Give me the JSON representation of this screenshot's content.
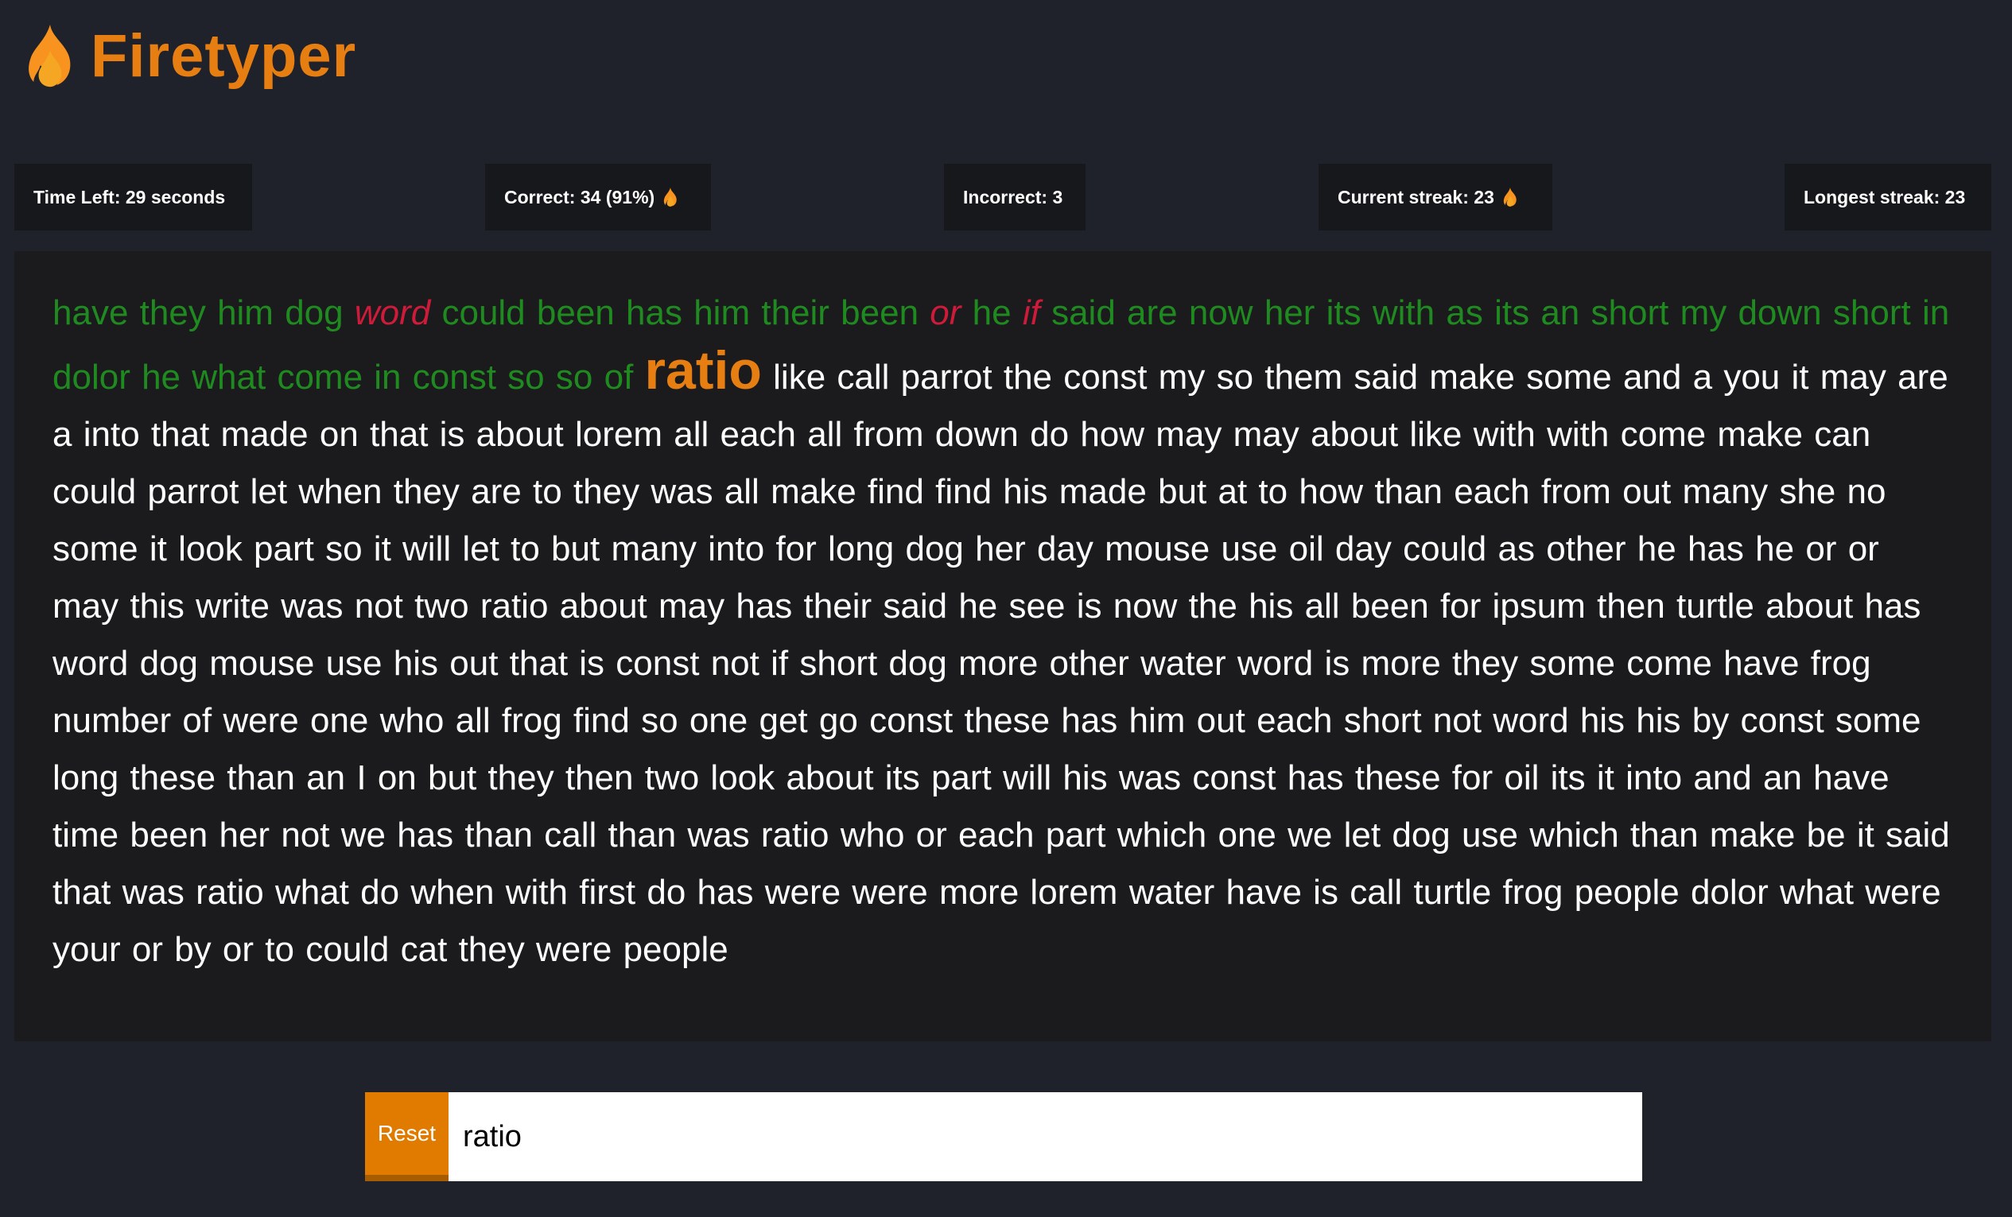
{
  "app": {
    "title": "Firetyper",
    "logo_icon": "flame-icon",
    "accent_color": "#e67e12"
  },
  "stats": {
    "time_left": {
      "label": "Time Left: ",
      "value": "29",
      "suffix": " seconds"
    },
    "correct": {
      "label": "Correct: ",
      "value": "34 (91%)",
      "icon": "flame-icon"
    },
    "incorrect": {
      "label": "Incorrect: ",
      "value": "3"
    },
    "current_streak": {
      "label": "Current streak: ",
      "value": "23",
      "icon": "flame-icon"
    },
    "longest_streak": {
      "label": "Longest streak: ",
      "value": "23"
    }
  },
  "colors": {
    "correct": "#1f8a1f",
    "incorrect": "#cf1b3a",
    "current": "#e67e12",
    "pending": "#ffffff"
  },
  "words": [
    {
      "t": "have",
      "s": "correct"
    },
    {
      "t": "they",
      "s": "correct"
    },
    {
      "t": "him",
      "s": "correct"
    },
    {
      "t": "dog",
      "s": "correct"
    },
    {
      "t": "word",
      "s": "incorrect"
    },
    {
      "t": "could",
      "s": "correct"
    },
    {
      "t": "been",
      "s": "correct"
    },
    {
      "t": "has",
      "s": "correct"
    },
    {
      "t": "him",
      "s": "correct"
    },
    {
      "t": "their",
      "s": "correct"
    },
    {
      "t": "been",
      "s": "correct"
    },
    {
      "t": "or",
      "s": "incorrect"
    },
    {
      "t": "he",
      "s": "correct"
    },
    {
      "t": "if",
      "s": "incorrect"
    },
    {
      "t": "said",
      "s": "correct"
    },
    {
      "t": "are",
      "s": "correct"
    },
    {
      "t": "now",
      "s": "correct"
    },
    {
      "t": "her",
      "s": "correct"
    },
    {
      "t": "its",
      "s": "correct"
    },
    {
      "t": "with",
      "s": "correct"
    },
    {
      "t": "as",
      "s": "correct"
    },
    {
      "t": "its",
      "s": "correct"
    },
    {
      "t": "an",
      "s": "correct"
    },
    {
      "t": "short",
      "s": "correct"
    },
    {
      "t": "my",
      "s": "correct"
    },
    {
      "t": "down",
      "s": "correct"
    },
    {
      "t": "short",
      "s": "correct"
    },
    {
      "t": "in",
      "s": "correct"
    },
    {
      "t": "dolor",
      "s": "correct"
    },
    {
      "t": "he",
      "s": "correct"
    },
    {
      "t": "what",
      "s": "correct"
    },
    {
      "t": "come",
      "s": "correct"
    },
    {
      "t": "in",
      "s": "correct"
    },
    {
      "t": "const",
      "s": "correct"
    },
    {
      "t": "so",
      "s": "correct"
    },
    {
      "t": "so",
      "s": "correct"
    },
    {
      "t": "of",
      "s": "correct"
    },
    {
      "t": "ratio",
      "s": "current"
    },
    {
      "t": "like",
      "s": "pending"
    },
    {
      "t": "call",
      "s": "pending"
    },
    {
      "t": "parrot",
      "s": "pending"
    },
    {
      "t": "the",
      "s": "pending"
    },
    {
      "t": "const",
      "s": "pending"
    },
    {
      "t": "my",
      "s": "pending"
    },
    {
      "t": "so",
      "s": "pending"
    },
    {
      "t": "them",
      "s": "pending"
    },
    {
      "t": "said",
      "s": "pending"
    },
    {
      "t": "make",
      "s": "pending"
    },
    {
      "t": "some",
      "s": "pending"
    },
    {
      "t": "and",
      "s": "pending"
    },
    {
      "t": "a",
      "s": "pending"
    },
    {
      "t": "you",
      "s": "pending"
    },
    {
      "t": "it",
      "s": "pending"
    },
    {
      "t": "may",
      "s": "pending"
    },
    {
      "t": "are",
      "s": "pending"
    },
    {
      "t": "a",
      "s": "pending"
    },
    {
      "t": "into",
      "s": "pending"
    },
    {
      "t": "that",
      "s": "pending"
    },
    {
      "t": "made",
      "s": "pending"
    },
    {
      "t": "on",
      "s": "pending"
    },
    {
      "t": "that",
      "s": "pending"
    },
    {
      "t": "is",
      "s": "pending"
    },
    {
      "t": "about",
      "s": "pending"
    },
    {
      "t": "lorem",
      "s": "pending"
    },
    {
      "t": "all",
      "s": "pending"
    },
    {
      "t": "each",
      "s": "pending"
    },
    {
      "t": "all",
      "s": "pending"
    },
    {
      "t": "from",
      "s": "pending"
    },
    {
      "t": "down",
      "s": "pending"
    },
    {
      "t": "do",
      "s": "pending"
    },
    {
      "t": "how",
      "s": "pending"
    },
    {
      "t": "may",
      "s": "pending"
    },
    {
      "t": "may",
      "s": "pending"
    },
    {
      "t": "about",
      "s": "pending"
    },
    {
      "t": "like",
      "s": "pending"
    },
    {
      "t": "with",
      "s": "pending"
    },
    {
      "t": "with",
      "s": "pending"
    },
    {
      "t": "come",
      "s": "pending"
    },
    {
      "t": "make",
      "s": "pending"
    },
    {
      "t": "can",
      "s": "pending"
    },
    {
      "t": "could",
      "s": "pending"
    },
    {
      "t": "parrot",
      "s": "pending"
    },
    {
      "t": "let",
      "s": "pending"
    },
    {
      "t": "when",
      "s": "pending"
    },
    {
      "t": "they",
      "s": "pending"
    },
    {
      "t": "are",
      "s": "pending"
    },
    {
      "t": "to",
      "s": "pending"
    },
    {
      "t": "they",
      "s": "pending"
    },
    {
      "t": "was",
      "s": "pending"
    },
    {
      "t": "all",
      "s": "pending"
    },
    {
      "t": "make",
      "s": "pending"
    },
    {
      "t": "find",
      "s": "pending"
    },
    {
      "t": "find",
      "s": "pending"
    },
    {
      "t": "his",
      "s": "pending"
    },
    {
      "t": "made",
      "s": "pending"
    },
    {
      "t": "but",
      "s": "pending"
    },
    {
      "t": "at",
      "s": "pending"
    },
    {
      "t": "to",
      "s": "pending"
    },
    {
      "t": "how",
      "s": "pending"
    },
    {
      "t": "than",
      "s": "pending"
    },
    {
      "t": "each",
      "s": "pending"
    },
    {
      "t": "from",
      "s": "pending"
    },
    {
      "t": "out",
      "s": "pending"
    },
    {
      "t": "many",
      "s": "pending"
    },
    {
      "t": "she",
      "s": "pending"
    },
    {
      "t": "no",
      "s": "pending"
    },
    {
      "t": "some",
      "s": "pending"
    },
    {
      "t": "it",
      "s": "pending"
    },
    {
      "t": "look",
      "s": "pending"
    },
    {
      "t": "part",
      "s": "pending"
    },
    {
      "t": "so",
      "s": "pending"
    },
    {
      "t": "it",
      "s": "pending"
    },
    {
      "t": "will",
      "s": "pending"
    },
    {
      "t": "let",
      "s": "pending"
    },
    {
      "t": "to",
      "s": "pending"
    },
    {
      "t": "but",
      "s": "pending"
    },
    {
      "t": "many",
      "s": "pending"
    },
    {
      "t": "into",
      "s": "pending"
    },
    {
      "t": "for",
      "s": "pending"
    },
    {
      "t": "long",
      "s": "pending"
    },
    {
      "t": "dog",
      "s": "pending"
    },
    {
      "t": "her",
      "s": "pending"
    },
    {
      "t": "day",
      "s": "pending"
    },
    {
      "t": "mouse",
      "s": "pending"
    },
    {
      "t": "use",
      "s": "pending"
    },
    {
      "t": "oil",
      "s": "pending"
    },
    {
      "t": "day",
      "s": "pending"
    },
    {
      "t": "could",
      "s": "pending"
    },
    {
      "t": "as",
      "s": "pending"
    },
    {
      "t": "other",
      "s": "pending"
    },
    {
      "t": "he",
      "s": "pending"
    },
    {
      "t": "has",
      "s": "pending"
    },
    {
      "t": "he",
      "s": "pending"
    },
    {
      "t": "or",
      "s": "pending"
    },
    {
      "t": "or",
      "s": "pending"
    },
    {
      "t": "may",
      "s": "pending"
    },
    {
      "t": "this",
      "s": "pending"
    },
    {
      "t": "write",
      "s": "pending"
    },
    {
      "t": "was",
      "s": "pending"
    },
    {
      "t": "not",
      "s": "pending"
    },
    {
      "t": "two",
      "s": "pending"
    },
    {
      "t": "ratio",
      "s": "pending"
    },
    {
      "t": "about",
      "s": "pending"
    },
    {
      "t": "may",
      "s": "pending"
    },
    {
      "t": "has",
      "s": "pending"
    },
    {
      "t": "their",
      "s": "pending"
    },
    {
      "t": "said",
      "s": "pending"
    },
    {
      "t": "he",
      "s": "pending"
    },
    {
      "t": "see",
      "s": "pending"
    },
    {
      "t": "is",
      "s": "pending"
    },
    {
      "t": "now",
      "s": "pending"
    },
    {
      "t": "the",
      "s": "pending"
    },
    {
      "t": "his",
      "s": "pending"
    },
    {
      "t": "all",
      "s": "pending"
    },
    {
      "t": "been",
      "s": "pending"
    },
    {
      "t": "for",
      "s": "pending"
    },
    {
      "t": "ipsum",
      "s": "pending"
    },
    {
      "t": "then",
      "s": "pending"
    },
    {
      "t": "turtle",
      "s": "pending"
    },
    {
      "t": "about",
      "s": "pending"
    },
    {
      "t": "has",
      "s": "pending"
    },
    {
      "t": "word",
      "s": "pending"
    },
    {
      "t": "dog",
      "s": "pending"
    },
    {
      "t": "mouse",
      "s": "pending"
    },
    {
      "t": "use",
      "s": "pending"
    },
    {
      "t": "his",
      "s": "pending"
    },
    {
      "t": "out",
      "s": "pending"
    },
    {
      "t": "that",
      "s": "pending"
    },
    {
      "t": "is",
      "s": "pending"
    },
    {
      "t": "const",
      "s": "pending"
    },
    {
      "t": "not",
      "s": "pending"
    },
    {
      "t": "if",
      "s": "pending"
    },
    {
      "t": "short",
      "s": "pending"
    },
    {
      "t": "dog",
      "s": "pending"
    },
    {
      "t": "more",
      "s": "pending"
    },
    {
      "t": "other",
      "s": "pending"
    },
    {
      "t": "water",
      "s": "pending"
    },
    {
      "t": "word",
      "s": "pending"
    },
    {
      "t": "is",
      "s": "pending"
    },
    {
      "t": "more",
      "s": "pending"
    },
    {
      "t": "they",
      "s": "pending"
    },
    {
      "t": "some",
      "s": "pending"
    },
    {
      "t": "come",
      "s": "pending"
    },
    {
      "t": "have",
      "s": "pending"
    },
    {
      "t": "frog",
      "s": "pending"
    },
    {
      "t": "number",
      "s": "pending"
    },
    {
      "t": "of",
      "s": "pending"
    },
    {
      "t": "were",
      "s": "pending"
    },
    {
      "t": "one",
      "s": "pending"
    },
    {
      "t": "who",
      "s": "pending"
    },
    {
      "t": "all",
      "s": "pending"
    },
    {
      "t": "frog",
      "s": "pending"
    },
    {
      "t": "find",
      "s": "pending"
    },
    {
      "t": "so",
      "s": "pending"
    },
    {
      "t": "one",
      "s": "pending"
    },
    {
      "t": "get",
      "s": "pending"
    },
    {
      "t": "go",
      "s": "pending"
    },
    {
      "t": "const",
      "s": "pending"
    },
    {
      "t": "these",
      "s": "pending"
    },
    {
      "t": "has",
      "s": "pending"
    },
    {
      "t": "him",
      "s": "pending"
    },
    {
      "t": "out",
      "s": "pending"
    },
    {
      "t": "each",
      "s": "pending"
    },
    {
      "t": "short",
      "s": "pending"
    },
    {
      "t": "not",
      "s": "pending"
    },
    {
      "t": "word",
      "s": "pending"
    },
    {
      "t": "his",
      "s": "pending"
    },
    {
      "t": "his",
      "s": "pending"
    },
    {
      "t": "by",
      "s": "pending"
    },
    {
      "t": "const",
      "s": "pending"
    },
    {
      "t": "some",
      "s": "pending"
    },
    {
      "t": "long",
      "s": "pending"
    },
    {
      "t": "these",
      "s": "pending"
    },
    {
      "t": "than",
      "s": "pending"
    },
    {
      "t": "an",
      "s": "pending"
    },
    {
      "t": "I",
      "s": "pending"
    },
    {
      "t": "on",
      "s": "pending"
    },
    {
      "t": "but",
      "s": "pending"
    },
    {
      "t": "they",
      "s": "pending"
    },
    {
      "t": "then",
      "s": "pending"
    },
    {
      "t": "two",
      "s": "pending"
    },
    {
      "t": "look",
      "s": "pending"
    },
    {
      "t": "about",
      "s": "pending"
    },
    {
      "t": "its",
      "s": "pending"
    },
    {
      "t": "part",
      "s": "pending"
    },
    {
      "t": "will",
      "s": "pending"
    },
    {
      "t": "his",
      "s": "pending"
    },
    {
      "t": "was",
      "s": "pending"
    },
    {
      "t": "const",
      "s": "pending"
    },
    {
      "t": "has",
      "s": "pending"
    },
    {
      "t": "these",
      "s": "pending"
    },
    {
      "t": "for",
      "s": "pending"
    },
    {
      "t": "oil",
      "s": "pending"
    },
    {
      "t": "its",
      "s": "pending"
    },
    {
      "t": "it",
      "s": "pending"
    },
    {
      "t": "into",
      "s": "pending"
    },
    {
      "t": "and",
      "s": "pending"
    },
    {
      "t": "an",
      "s": "pending"
    },
    {
      "t": "have",
      "s": "pending"
    },
    {
      "t": "time",
      "s": "pending"
    },
    {
      "t": "been",
      "s": "pending"
    },
    {
      "t": "her",
      "s": "pending"
    },
    {
      "t": "not",
      "s": "pending"
    },
    {
      "t": "we",
      "s": "pending"
    },
    {
      "t": "has",
      "s": "pending"
    },
    {
      "t": "than",
      "s": "pending"
    },
    {
      "t": "call",
      "s": "pending"
    },
    {
      "t": "than",
      "s": "pending"
    },
    {
      "t": "was",
      "s": "pending"
    },
    {
      "t": "ratio",
      "s": "pending"
    },
    {
      "t": "who",
      "s": "pending"
    },
    {
      "t": "or",
      "s": "pending"
    },
    {
      "t": "each",
      "s": "pending"
    },
    {
      "t": "part",
      "s": "pending"
    },
    {
      "t": "which",
      "s": "pending"
    },
    {
      "t": "one",
      "s": "pending"
    },
    {
      "t": "we",
      "s": "pending"
    },
    {
      "t": "let",
      "s": "pending"
    },
    {
      "t": "dog",
      "s": "pending"
    },
    {
      "t": "use",
      "s": "pending"
    },
    {
      "t": "which",
      "s": "pending"
    },
    {
      "t": "than",
      "s": "pending"
    },
    {
      "t": "make",
      "s": "pending"
    },
    {
      "t": "be",
      "s": "pending"
    },
    {
      "t": "it",
      "s": "pending"
    },
    {
      "t": "said",
      "s": "pending"
    },
    {
      "t": "that",
      "s": "pending"
    },
    {
      "t": "was",
      "s": "pending"
    },
    {
      "t": "ratio",
      "s": "pending"
    },
    {
      "t": "what",
      "s": "pending"
    },
    {
      "t": "do",
      "s": "pending"
    },
    {
      "t": "when",
      "s": "pending"
    },
    {
      "t": "with",
      "s": "pending"
    },
    {
      "t": "first",
      "s": "pending"
    },
    {
      "t": "do",
      "s": "pending"
    },
    {
      "t": "has",
      "s": "pending"
    },
    {
      "t": "were",
      "s": "pending"
    },
    {
      "t": "were",
      "s": "pending"
    },
    {
      "t": "more",
      "s": "pending"
    },
    {
      "t": "lorem",
      "s": "pending"
    },
    {
      "t": "water",
      "s": "pending"
    },
    {
      "t": "have",
      "s": "pending"
    },
    {
      "t": "is",
      "s": "pending"
    },
    {
      "t": "call",
      "s": "pending"
    },
    {
      "t": "turtle",
      "s": "pending"
    },
    {
      "t": "frog",
      "s": "pending"
    },
    {
      "t": "people",
      "s": "pending"
    },
    {
      "t": "dolor",
      "s": "pending"
    },
    {
      "t": "what",
      "s": "pending"
    },
    {
      "t": "were",
      "s": "pending"
    },
    {
      "t": "your",
      "s": "pending"
    },
    {
      "t": "or",
      "s": "pending"
    },
    {
      "t": "by",
      "s": "pending"
    },
    {
      "t": "or",
      "s": "pending"
    },
    {
      "t": "to",
      "s": "pending"
    },
    {
      "t": "could",
      "s": "pending"
    },
    {
      "t": "cat",
      "s": "pending"
    },
    {
      "t": "they",
      "s": "pending"
    },
    {
      "t": "were",
      "s": "pending"
    },
    {
      "t": "people",
      "s": "pending"
    }
  ],
  "controls": {
    "reset_label": "Reset",
    "input_value": "ratio"
  }
}
